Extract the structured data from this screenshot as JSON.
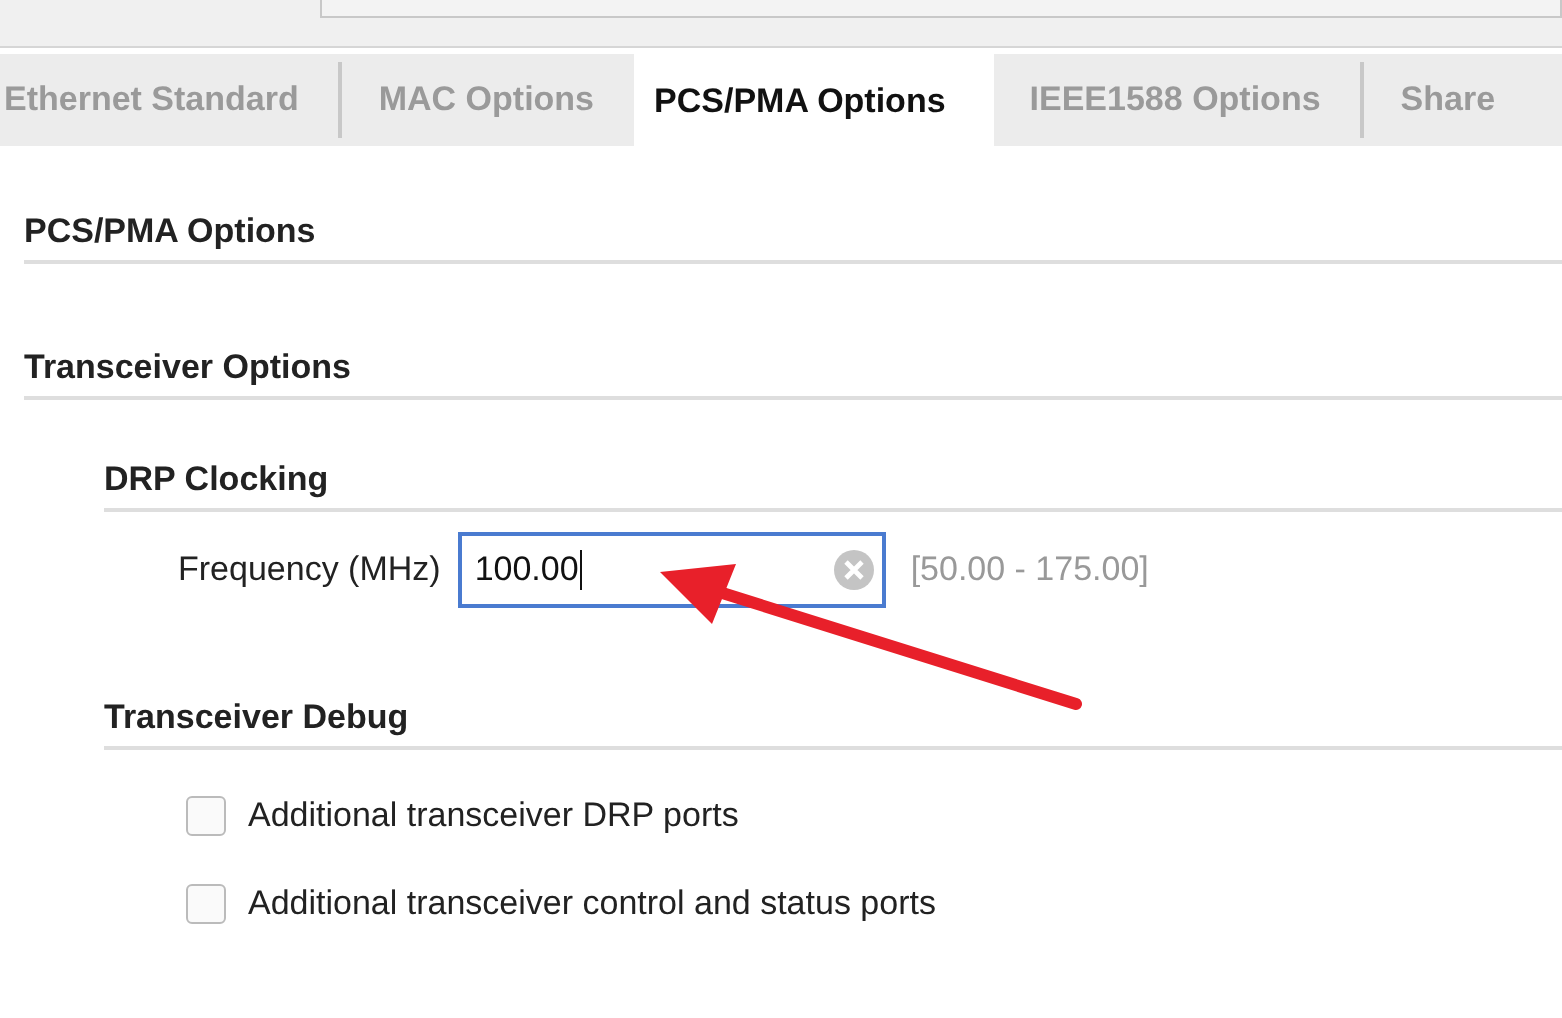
{
  "tabs": [
    {
      "label": "Ethernet Standard",
      "selected": false
    },
    {
      "label": "MAC Options",
      "selected": false
    },
    {
      "label": "PCS/PMA Options",
      "selected": true
    },
    {
      "label": "IEEE1588 Options",
      "selected": false
    },
    {
      "label": "Share",
      "selected": false
    }
  ],
  "page_title": "PCS/PMA Options",
  "section": {
    "title": "Transceiver Options",
    "groups": [
      {
        "title": "DRP Clocking",
        "rows": [
          {
            "kind": "field",
            "label": "Frequency (MHz)",
            "value": "100.00",
            "range": "[50.00 - 175.00]"
          }
        ]
      },
      {
        "title": "Transceiver Debug",
        "rows": [
          {
            "kind": "checkbox",
            "label": "Additional transceiver DRP ports",
            "checked": false
          },
          {
            "kind": "checkbox",
            "label": "Additional transceiver control and status ports",
            "checked": false
          }
        ]
      }
    ]
  }
}
